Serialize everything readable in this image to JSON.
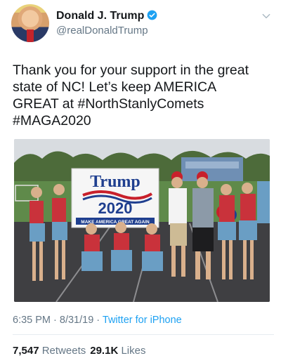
{
  "user": {
    "name": "Donald J. Trump",
    "handle": "@realDonaldTrump"
  },
  "tweet": {
    "lines": [
      "Thank you for your support in the great",
      "state of NC!  Let’s keep AMERICA",
      "GREAT at #NorthStanlyComets",
      "#MAGA2020"
    ]
  },
  "photo": {
    "banner_line1": "Trump",
    "banner_line2": "2020",
    "banner_line3": "MAKE AMERICA GREAT AGAIN"
  },
  "meta": {
    "time": "6:35 PM",
    "separator1": " · ",
    "date": "8/31/19",
    "separator2": " · ",
    "source": "Twitter for iPhone"
  },
  "stats": {
    "retweets_count": "7,547",
    "retweets_label": "Retweets",
    "likes_count": "29.1K",
    "likes_label": "Likes"
  },
  "colors": {
    "verified": "#1da1f2",
    "secondary_text": "#657786",
    "link": "#1da1f2"
  }
}
